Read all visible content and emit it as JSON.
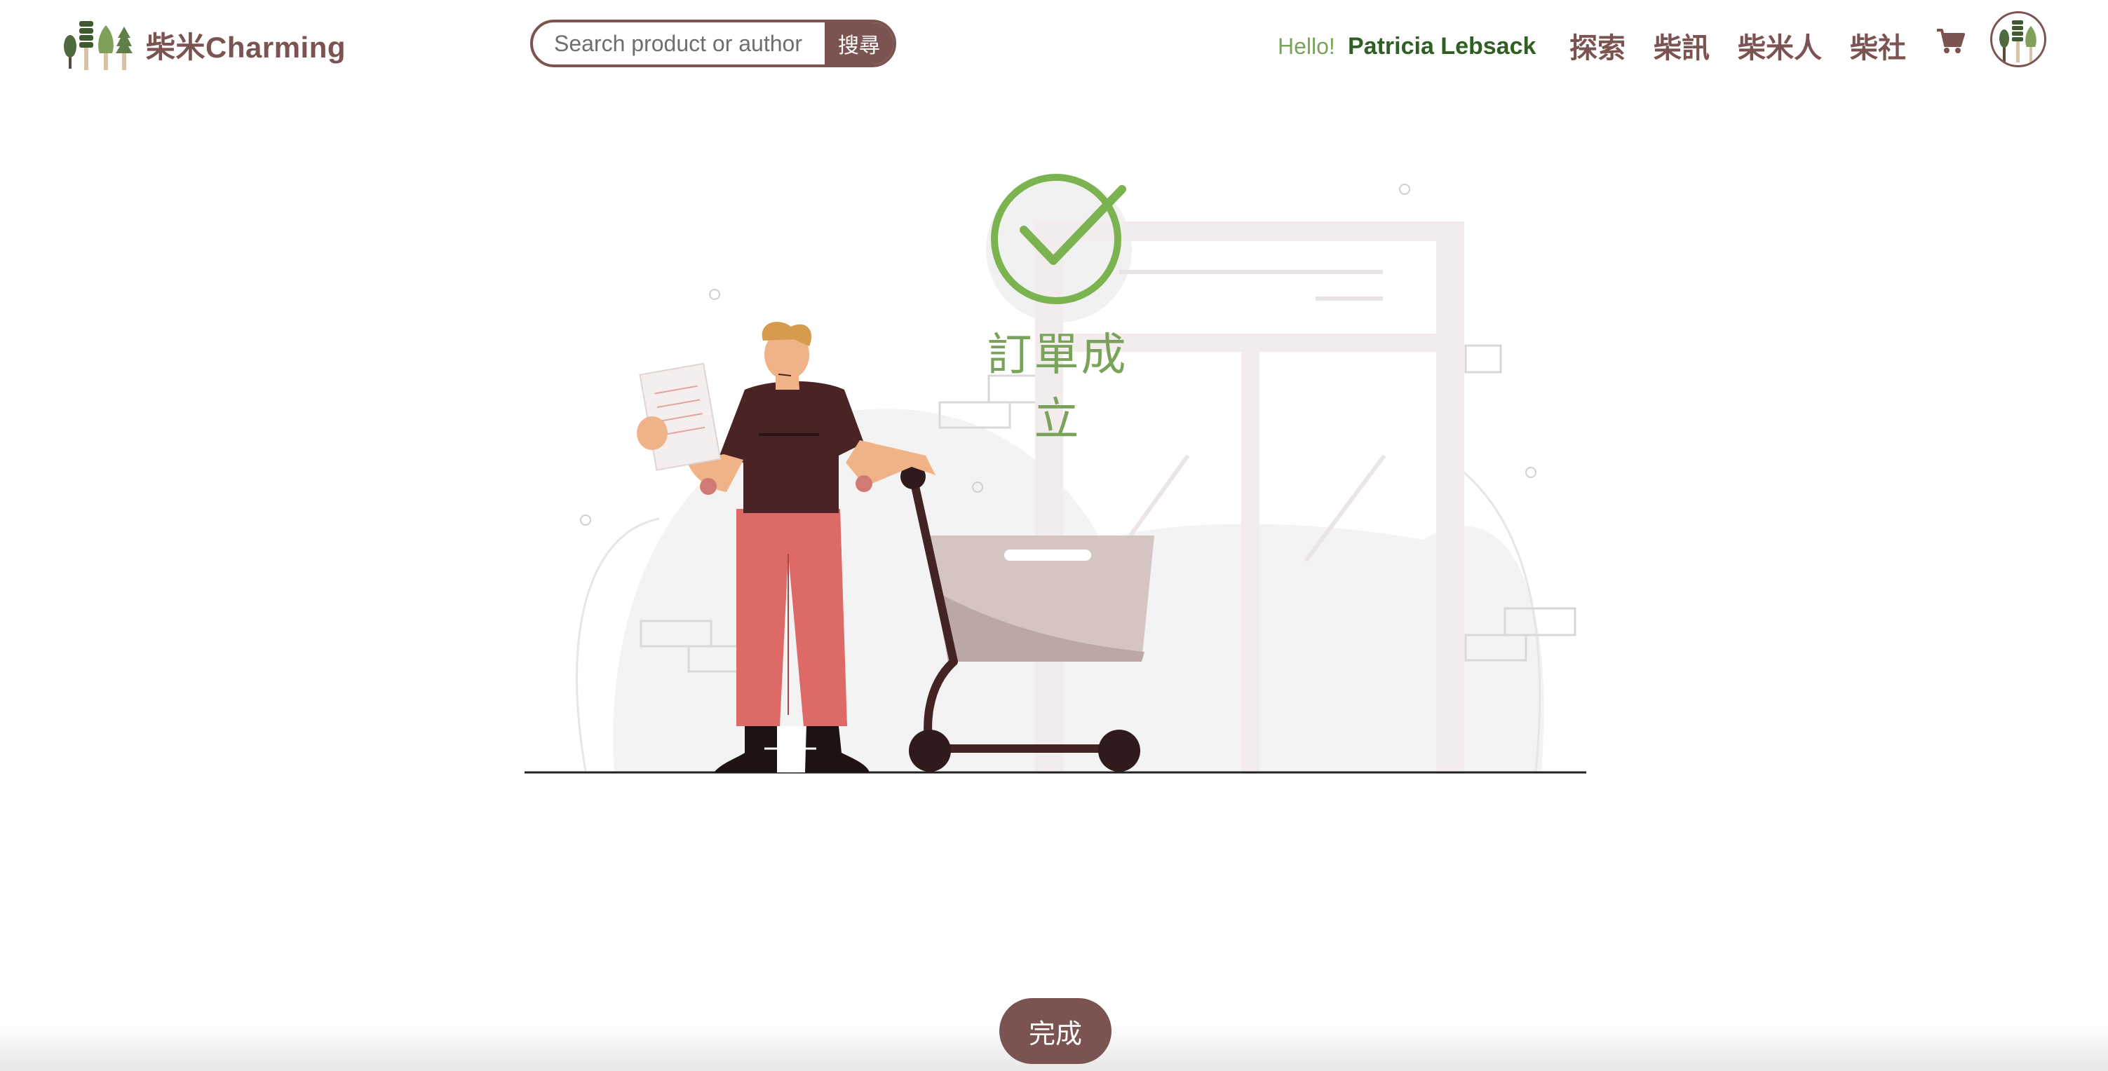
{
  "header": {
    "brand": "柴米Charming",
    "search": {
      "placeholder": "Search product or author",
      "value": "",
      "button_label": "搜尋"
    },
    "greeting": {
      "hello": "Hello!",
      "user_name": "Patricia Lebsack"
    },
    "nav": [
      {
        "label": "探索"
      },
      {
        "label": "柴訊"
      },
      {
        "label": "柴米人"
      },
      {
        "label": "柴社"
      }
    ],
    "icons": {
      "cart": "cart-icon",
      "avatar": "avatar"
    }
  },
  "main": {
    "status_icon": "check-circle-icon",
    "title": "訂單成立",
    "done_label": "完成"
  },
  "colors": {
    "brand_brown": "#7b5350",
    "success_green": "#79a35b",
    "name_green": "#2f5f22",
    "shirt": "#4a2424",
    "pants": "#dd6a66",
    "basket": "#d4c4c2"
  }
}
